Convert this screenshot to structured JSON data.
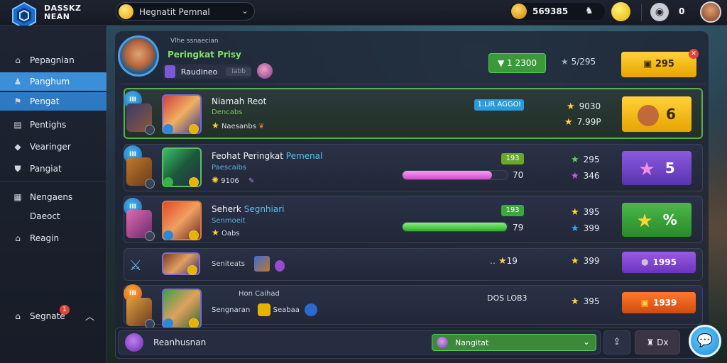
{
  "app": {
    "logo_text_line1": "DASSKZ",
    "logo_text_line2": "NEAN",
    "search_value": "Hegnatit Pemnal",
    "currency_value": "569385",
    "notification_count": "0"
  },
  "sidebar": {
    "items": [
      {
        "label": "Pepagnian",
        "icon": "home-icon"
      },
      {
        "label": "Panghum",
        "icon": "people-icon"
      },
      {
        "label": "Pengat",
        "icon": "flag-icon"
      },
      {
        "label": "Pentighs",
        "icon": "cards-icon"
      },
      {
        "label": "Vearinger",
        "icon": "diamond-icon"
      },
      {
        "label": "Pangiat",
        "icon": "shield-icon"
      },
      {
        "label": "Nengaens",
        "icon": "chart-icon"
      },
      {
        "label": "Daeoct",
        "icon": ""
      },
      {
        "label": "Reagin",
        "icon": "home-icon"
      }
    ],
    "footer_label": "Segnate",
    "footer_badge": "1"
  },
  "header": {
    "subtitle": "Vlhe ssnaecian",
    "title": "Peringkat Prisy",
    "chip_label": "Raudineo",
    "chip_tag": "Iabb",
    "green_button": "1 2300",
    "stat": "5/295",
    "gold_button": "295"
  },
  "rows": [
    {
      "rank": "III",
      "name": "Niamah Reot",
      "sub": "Dencabs",
      "line": "Naesanbs",
      "pill": "1.LiR AGGOI",
      "stat1": "9030",
      "stat2": "7.99P",
      "action": "6"
    },
    {
      "rank": "III",
      "name_main": "Feohat Peringkat",
      "name_hl": "Pemenal",
      "sub": "Paescaibs",
      "line": "9106",
      "pill": "193",
      "progress": 0.85,
      "progress_label": "70",
      "stat1": "295",
      "stat2": "346",
      "action": "5"
    },
    {
      "rank": "III",
      "name_main": "Seherk",
      "name_hl": "Segnhiari",
      "sub": "Senmoeit",
      "line": "Oabs",
      "pill": "193",
      "progress": 0.99,
      "progress_label": "79",
      "stat1": "395",
      "stat2": "399",
      "action": "%"
    },
    {
      "rank": "",
      "name": "Seniteats",
      "pill_text": "19",
      "stat1": "399",
      "action": "1995"
    },
    {
      "rank": "III",
      "title": "Hon Caihad",
      "name": "Sengnaran",
      "line": "Seabaa",
      "mid": "DOS LOB3",
      "stat1": "395",
      "action": "1939"
    }
  ],
  "bottom": {
    "field_text": "Reanhusnan",
    "select_value": "Nangitat",
    "btn2_label": "Dx"
  }
}
